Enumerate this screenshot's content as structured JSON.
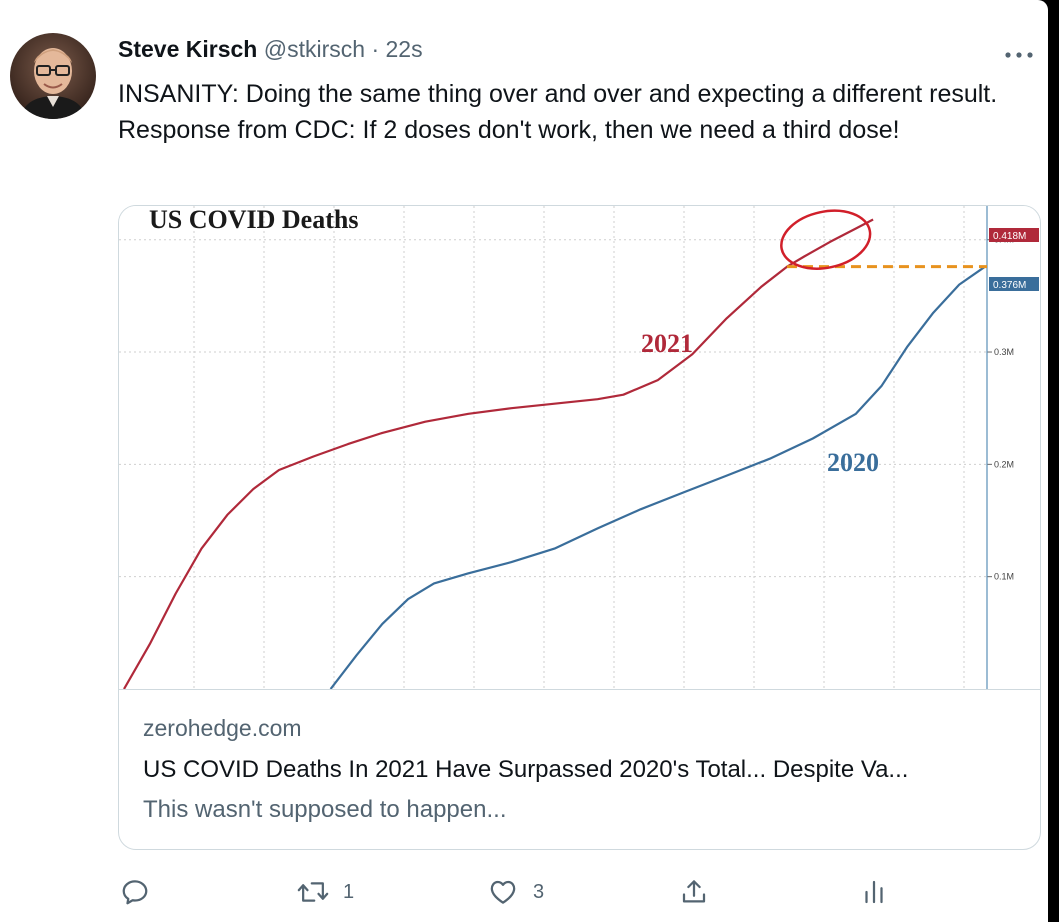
{
  "tweet": {
    "author_name": "Steve Kirsch",
    "handle": "@stkirsch",
    "separator": "·",
    "time": "22s",
    "text": "INSANITY: Doing the same thing over and over and expecting a different result. Response from CDC: If 2 doses don't work, then we need a third dose!"
  },
  "card": {
    "domain": "zerohedge.com",
    "title": "US COVID Deaths In 2021 Have Surpassed 2020's Total... Despite Va...",
    "description": "This wasn't supposed to happen..."
  },
  "actions": {
    "reply_icon": "reply-icon",
    "retweet_icon": "retweet-icon",
    "retweet_count": "1",
    "like_icon": "heart-icon",
    "like_count": "3",
    "share_icon": "share-icon",
    "analytics_icon": "analytics-icon"
  },
  "colors": {
    "series_2021": "#b0293a",
    "series_2020": "#3a6e9b",
    "threshold_line": "#e8921e",
    "text_primary": "#0f1419",
    "text_muted": "#536471"
  },
  "chart_data": {
    "type": "line",
    "title": "US COVID Deaths",
    "ylim": [
      0,
      0.43
    ],
    "yticks": [
      {
        "value": 0.1,
        "label": "0.1M"
      },
      {
        "value": 0.2,
        "label": "0.2M"
      },
      {
        "value": 0.3,
        "label": "0.3M"
      },
      {
        "value": 0.4,
        "label": "0.4M"
      }
    ],
    "grid": true,
    "series": [
      {
        "name": "2021",
        "color": "#b0293a",
        "last_value_label": "0.418M",
        "points": [
          [
            0.0,
            0.0
          ],
          [
            0.03,
            0.04
          ],
          [
            0.06,
            0.085
          ],
          [
            0.09,
            0.125
          ],
          [
            0.12,
            0.155
          ],
          [
            0.15,
            0.178
          ],
          [
            0.18,
            0.195
          ],
          [
            0.22,
            0.207
          ],
          [
            0.26,
            0.218
          ],
          [
            0.3,
            0.228
          ],
          [
            0.35,
            0.238
          ],
          [
            0.4,
            0.245
          ],
          [
            0.45,
            0.25
          ],
          [
            0.5,
            0.254
          ],
          [
            0.55,
            0.258
          ],
          [
            0.58,
            0.262
          ],
          [
            0.62,
            0.275
          ],
          [
            0.66,
            0.298
          ],
          [
            0.7,
            0.33
          ],
          [
            0.74,
            0.358
          ],
          [
            0.77,
            0.376
          ],
          [
            0.79,
            0.385
          ],
          [
            0.82,
            0.398
          ],
          [
            0.85,
            0.41
          ],
          [
            0.87,
            0.418
          ]
        ]
      },
      {
        "name": "2020",
        "color": "#3a6e9b",
        "last_value_label": "0.376M",
        "points": [
          [
            0.24,
            0.0
          ],
          [
            0.27,
            0.03
          ],
          [
            0.3,
            0.058
          ],
          [
            0.33,
            0.08
          ],
          [
            0.36,
            0.094
          ],
          [
            0.4,
            0.103
          ],
          [
            0.45,
            0.113
          ],
          [
            0.5,
            0.125
          ],
          [
            0.55,
            0.143
          ],
          [
            0.6,
            0.16
          ],
          [
            0.65,
            0.175
          ],
          [
            0.7,
            0.19
          ],
          [
            0.75,
            0.205
          ],
          [
            0.8,
            0.223
          ],
          [
            0.85,
            0.245
          ],
          [
            0.88,
            0.27
          ],
          [
            0.91,
            0.305
          ],
          [
            0.94,
            0.335
          ],
          [
            0.97,
            0.36
          ],
          [
            1.0,
            0.376
          ]
        ]
      }
    ]
  }
}
